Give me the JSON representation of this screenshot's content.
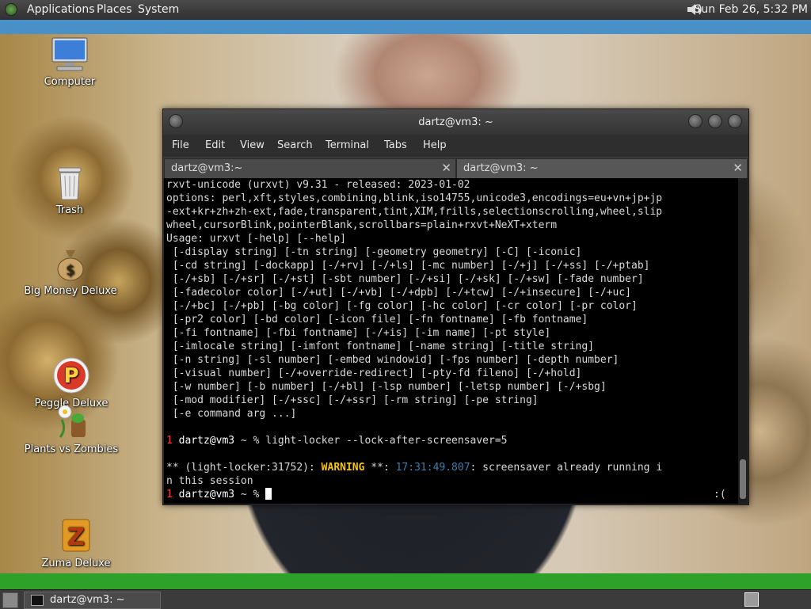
{
  "top_panel": {
    "menus": [
      "Applications",
      "Places",
      "System"
    ],
    "clock": "Sun Feb 26,  5:32 PM"
  },
  "desktop_icons": [
    {
      "label": "Computer"
    },
    {
      "label": "Trash"
    },
    {
      "label": "Big Money Deluxe"
    },
    {
      "label": "Peggle Deluxe"
    },
    {
      "label": "Plants vs Zombies"
    },
    {
      "label": "Zuma Deluxe"
    }
  ],
  "terminal": {
    "title": "dartz@vm3: ~",
    "menus": [
      "File",
      "Edit",
      "View",
      "Search",
      "Terminal",
      "Tabs",
      "Help"
    ],
    "tabs": [
      {
        "label": "dartz@vm3:~"
      },
      {
        "label": "dartz@vm3: ~"
      }
    ],
    "lines": [
      "rxvt-unicode (urxvt) v9.31 - released: 2023-01-02",
      "options: perl,xft,styles,combining,blink,iso14755,unicode3,encodings=eu+vn+jp+jp",
      "-ext+kr+zh+zh-ext,fade,transparent,tint,XIM,frills,selectionscrolling,wheel,slip",
      "wheel,cursorBlink,pointerBlank,scrollbars=plain+rxvt+NeXT+xterm",
      "Usage: urxvt [-help] [--help]",
      " [-display string] [-tn string] [-geometry geometry] [-C] [-iconic]",
      " [-cd string] [-dockapp] [-/+rv] [-/+ls] [-mc number] [-/+j] [-/+ss] [-/+ptab]",
      " [-/+sb] [-/+sr] [-/+st] [-sbt number] [-/+si] [-/+sk] [-/+sw] [-fade number]",
      " [-fadecolor color] [-/+ut] [-/+vb] [-/+dpb] [-/+tcw] [-/+insecure] [-/+uc]",
      " [-/+bc] [-/+pb] [-bg color] [-fg color] [-hc color] [-cr color] [-pr color]",
      " [-pr2 color] [-bd color] [-icon file] [-fn fontname] [-fb fontname]",
      " [-fi fontname] [-fbi fontname] [-/+is] [-im name] [-pt style]",
      " [-imlocale string] [-imfont fontname] [-name string] [-title string]",
      " [-n string] [-sl number] [-embed windowid] [-fps number] [-depth number]",
      " [-visual number] [-/+override-redirect] [-pty-fd fileno] [-/+hold]",
      " [-w number] [-b number] [-/+bl] [-lsp number] [-letsp number] [-/+sbg]",
      " [-mod modifier] [-/+ssc] [-/+ssr] [-rm string] [-pe string]",
      " [-e command arg ...]"
    ],
    "prompt1": {
      "num": "1",
      "user": "dartz@vm3",
      "sep": " ~ % ",
      "cmd": "light-locker --lock-after-screensaver=5"
    },
    "warning": {
      "prefix": "** (light-locker:31752): ",
      "level": "WARNING",
      "mid": " **: ",
      "time": "17:31:49.807",
      "msg_a": ": screensaver already running i",
      "msg_b": "n this session"
    },
    "prompt2": {
      "num": "1",
      "user": "dartz@vm3",
      "sep": " ~ % "
    },
    "status_right": ":("
  },
  "taskbar": {
    "window_label": "dartz@vm3: ~"
  },
  "colors": {
    "top_panel": "#3b3b3b",
    "blue_strip": "#4a90c8",
    "green_strip": "#2ea12a",
    "prompt_red": "#ff3b3b",
    "warning_yellow": "#f3c21b",
    "timestamp_blue": "#3d7fb0"
  }
}
